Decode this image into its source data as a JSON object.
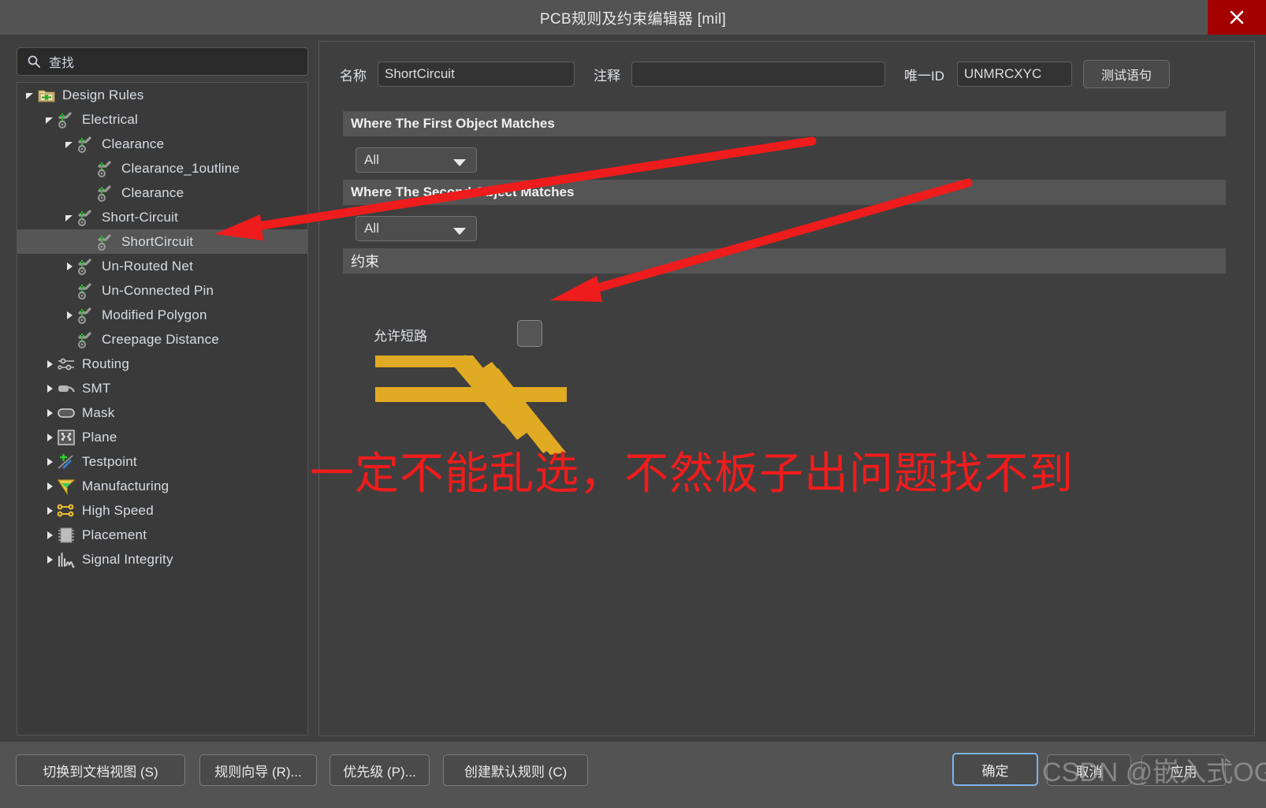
{
  "window": {
    "title": "PCB规则及约束编辑器 [mil]",
    "close_icon": "close-icon",
    "close_color": "#a50000"
  },
  "search": {
    "placeholder": "查找",
    "icon": "search-icon"
  },
  "tree": {
    "nodes": [
      {
        "label": "Design Rules",
        "depth": 0,
        "twist": "down",
        "icon": "folder-rules-icon",
        "selected": false
      },
      {
        "label": "Electrical",
        "depth": 1,
        "twist": "down",
        "icon": "rule-electrical-icon",
        "selected": false
      },
      {
        "label": "Clearance",
        "depth": 2,
        "twist": "down",
        "icon": "rule-electrical-icon",
        "selected": false
      },
      {
        "label": "Clearance_1outline",
        "depth": 3,
        "twist": "none",
        "icon": "rule-electrical-icon",
        "selected": false
      },
      {
        "label": "Clearance",
        "depth": 3,
        "twist": "none",
        "icon": "rule-electrical-icon",
        "selected": false
      },
      {
        "label": "Short-Circuit",
        "depth": 2,
        "twist": "down",
        "icon": "rule-electrical-icon",
        "selected": false
      },
      {
        "label": "ShortCircuit",
        "depth": 3,
        "twist": "none",
        "icon": "rule-electrical-icon",
        "selected": true
      },
      {
        "label": "Un-Routed Net",
        "depth": 2,
        "twist": "right",
        "icon": "rule-electrical-icon",
        "selected": false
      },
      {
        "label": "Un-Connected Pin",
        "depth": 2,
        "twist": "none",
        "icon": "rule-electrical-icon",
        "selected": false
      },
      {
        "label": "Modified Polygon",
        "depth": 2,
        "twist": "right",
        "icon": "rule-electrical-icon",
        "selected": false
      },
      {
        "label": "Creepage Distance",
        "depth": 2,
        "twist": "none",
        "icon": "rule-electrical-icon",
        "selected": false
      },
      {
        "label": "Routing",
        "depth": 1,
        "twist": "right",
        "icon": "routing-icon",
        "selected": false
      },
      {
        "label": "SMT",
        "depth": 1,
        "twist": "right",
        "icon": "smt-icon",
        "selected": false
      },
      {
        "label": "Mask",
        "depth": 1,
        "twist": "right",
        "icon": "mask-icon",
        "selected": false
      },
      {
        "label": "Plane",
        "depth": 1,
        "twist": "right",
        "icon": "plane-icon",
        "selected": false
      },
      {
        "label": "Testpoint",
        "depth": 1,
        "twist": "right",
        "icon": "testpoint-icon",
        "selected": false
      },
      {
        "label": "Manufacturing",
        "depth": 1,
        "twist": "right",
        "icon": "manufacturing-icon",
        "selected": false
      },
      {
        "label": "High Speed",
        "depth": 1,
        "twist": "right",
        "icon": "highspeed-icon",
        "selected": false
      },
      {
        "label": "Placement",
        "depth": 1,
        "twist": "right",
        "icon": "placement-icon",
        "selected": false
      },
      {
        "label": "Signal Integrity",
        "depth": 1,
        "twist": "right",
        "icon": "signal-integrity-icon",
        "selected": false
      }
    ]
  },
  "editor": {
    "name_label": "名称",
    "name_value": "ShortCircuit",
    "comment_label": "注释",
    "comment_value": "",
    "uid_label": "唯一ID",
    "uid_value": "UNMRCXYC",
    "test_button": "测试语句",
    "first_object_header": "Where The First Object Matches",
    "first_object_scope": "All",
    "second_object_header": "Where The Second Object Matches",
    "second_object_scope": "All",
    "constraint_header": "约束",
    "allow_short_label": "允许短路",
    "allow_short_checked": false,
    "trace_color": "#e0aa22"
  },
  "annotation": {
    "text": "一定不能乱选，不然板子出问题找不到",
    "color": "#f01c1c",
    "arrows": 2
  },
  "footer": {
    "buttons": [
      {
        "label": "切换到文档视图 (S)"
      },
      {
        "label": "规则向导 (R)..."
      },
      {
        "label": "优先级 (P)..."
      },
      {
        "label": "创建默认规则 (C)"
      }
    ],
    "ok": "确定",
    "cancel": "取消",
    "apply": "应用"
  },
  "watermark": {
    "text": "CSDN @嵌入式OG"
  }
}
